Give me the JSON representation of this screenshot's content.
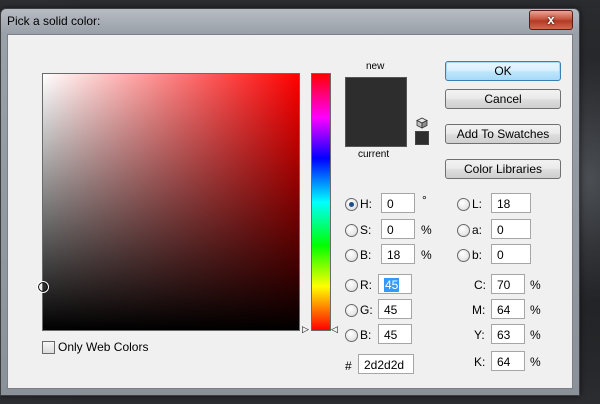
{
  "window": {
    "title": "Pick a solid color:",
    "close_glyph": "x"
  },
  "swatches": {
    "new_label": "new",
    "current_label": "current",
    "new_color": "#2d2d2d",
    "current_color": "#2d2d2d"
  },
  "buttons": {
    "ok": "OK",
    "cancel": "Cancel",
    "add_to_swatches": "Add To Swatches",
    "color_libraries": "Color Libraries"
  },
  "hsb": {
    "h": {
      "label": "H:",
      "value": "0",
      "unit": "°",
      "selected": true
    },
    "s": {
      "label": "S:",
      "value": "0",
      "unit": "%"
    },
    "b": {
      "label": "B:",
      "value": "18",
      "unit": "%"
    }
  },
  "rgb": {
    "r": {
      "label": "R:",
      "value": "45"
    },
    "g": {
      "label": "G:",
      "value": "45"
    },
    "b": {
      "label": "B:",
      "value": "45"
    }
  },
  "lab": {
    "l": {
      "label": "L:",
      "value": "18"
    },
    "a": {
      "label": "a:",
      "value": "0"
    },
    "b": {
      "label": "b:",
      "value": "0"
    }
  },
  "cmyk": {
    "c": {
      "label": "C:",
      "value": "70",
      "unit": "%"
    },
    "m": {
      "label": "M:",
      "value": "64",
      "unit": "%"
    },
    "y": {
      "label": "Y:",
      "value": "63",
      "unit": "%"
    },
    "k": {
      "label": "K:",
      "value": "64",
      "unit": "%"
    }
  },
  "hex": {
    "label": "#",
    "value": "2d2d2d"
  },
  "only_web_colors": {
    "label": "Only Web Colors",
    "checked": false
  },
  "colors": {
    "hue": "#ff0000",
    "accent": "#3399ff"
  }
}
